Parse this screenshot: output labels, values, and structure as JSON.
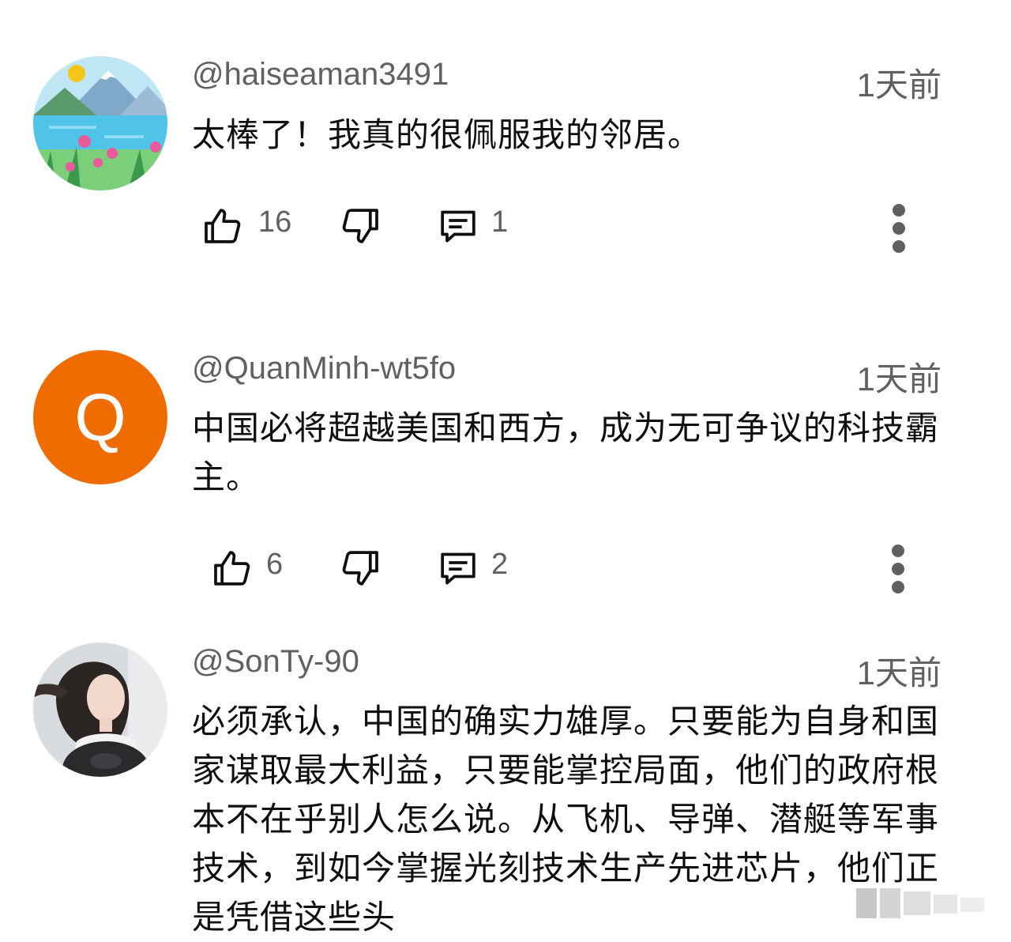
{
  "comments": [
    {
      "handle": "@haiseaman3491",
      "time": "1天前",
      "text": "太棒了！我真的很佩服我的邻居。",
      "likes": "16",
      "replies": "1",
      "avatar": "landscape-illustration"
    },
    {
      "handle": "@QuanMinh-wt5fo",
      "time": "1天前",
      "text": "中国必将超越美国和西方，成为无可争议的科技霸主。",
      "likes": "6",
      "replies": "2",
      "avatar_letter": "Q",
      "avatar_color": "#ef6c00"
    },
    {
      "handle": "@SonTy-90",
      "time": "1天前",
      "text": "必须承认，中国的确实力雄厚。只要能为自身和国家谋取最大利益，只要能掌控局面，他们的政府根本不在乎别人怎么说。从飞机、导弹、潜艇等军事技术，到如今掌握光刻技术生产先进芯片，他们正是凭借这些头",
      "avatar": "portrait-photo"
    }
  ],
  "icons": {
    "like": "thumbs-up-icon",
    "dislike": "thumbs-down-icon",
    "reply": "comment-icon",
    "more": "more-vertical-icon"
  }
}
